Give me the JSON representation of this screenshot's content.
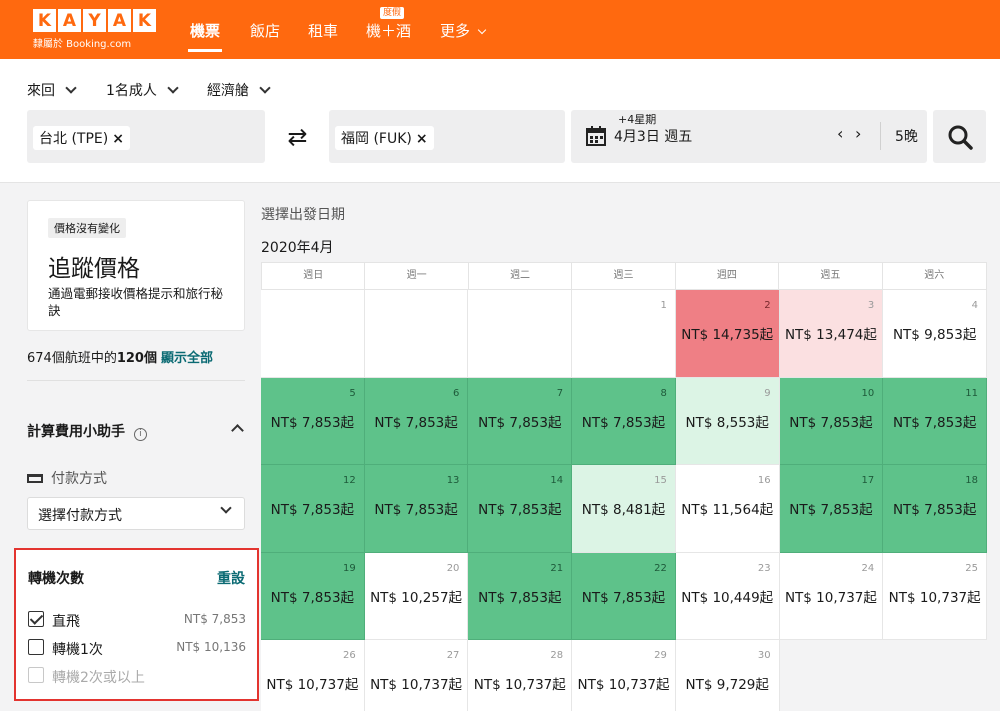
{
  "header": {
    "logo_letters": [
      "K",
      "A",
      "Y",
      "A",
      "K"
    ],
    "logo_sub": "隸屬於 Booking.com",
    "nav": [
      {
        "label": "機票",
        "active": true
      },
      {
        "label": "飯店",
        "active": false
      },
      {
        "label": "租車",
        "active": false
      },
      {
        "label": "機＋酒",
        "active": false
      },
      {
        "label": "更多",
        "active": false
      }
    ],
    "vacation_badge": "度假"
  },
  "search": {
    "trip_type": "來回",
    "travelers": "1名成人",
    "cabin": "經濟艙",
    "origin": "台北 (TPE)",
    "destination": "福岡 (FUK)",
    "date_hint": "+4星期",
    "date": "4月3日 週五",
    "nights": "5晚"
  },
  "sidebar": {
    "track_tag": "價格沒有變化",
    "track_title": "追蹤價格",
    "track_desc": "通過電郵接收價格提示和旅行秘訣",
    "count_total": "674個航班中的",
    "count_shown": "120個",
    "show_all": "顯示全部",
    "calc_title": "計算費用小助手",
    "pay_label": "付款方式",
    "pay_select": "選擇付款方式",
    "stops_title": "轉機次數",
    "stops_reset": "重設",
    "stops": [
      {
        "label": "直飛",
        "price": "NT$ 7,853",
        "checked": true,
        "disabled": false
      },
      {
        "label": "轉機1次",
        "price": "NT$ 10,136",
        "checked": false,
        "disabled": false
      },
      {
        "label": "轉機2次或以上",
        "price": "",
        "checked": false,
        "disabled": true
      }
    ]
  },
  "calendar": {
    "heading": "選擇出發日期",
    "month": "2020年4月",
    "weekdays": [
      "週日",
      "週一",
      "週二",
      "週三",
      "週四",
      "週五",
      "週六"
    ],
    "days": [
      {
        "d": "",
        "p": "",
        "c": ""
      },
      {
        "d": "",
        "p": "",
        "c": ""
      },
      {
        "d": "",
        "p": "",
        "c": ""
      },
      {
        "d": "1",
        "p": "",
        "c": ""
      },
      {
        "d": "2",
        "p": "NT$ 14,735起",
        "c": "red"
      },
      {
        "d": "3",
        "p": "NT$ 13,474起",
        "c": "pink"
      },
      {
        "d": "4",
        "p": "NT$ 9,853起",
        "c": ""
      },
      {
        "d": "5",
        "p": "NT$ 7,853起",
        "c": "green"
      },
      {
        "d": "6",
        "p": "NT$ 7,853起",
        "c": "green"
      },
      {
        "d": "7",
        "p": "NT$ 7,853起",
        "c": "green"
      },
      {
        "d": "8",
        "p": "NT$ 7,853起",
        "c": "green"
      },
      {
        "d": "9",
        "p": "NT$ 8,553起",
        "c": "lgreen"
      },
      {
        "d": "10",
        "p": "NT$ 7,853起",
        "c": "green"
      },
      {
        "d": "11",
        "p": "NT$ 7,853起",
        "c": "green"
      },
      {
        "d": "12",
        "p": "NT$ 7,853起",
        "c": "green"
      },
      {
        "d": "13",
        "p": "NT$ 7,853起",
        "c": "green"
      },
      {
        "d": "14",
        "p": "NT$ 7,853起",
        "c": "green"
      },
      {
        "d": "15",
        "p": "NT$ 8,481起",
        "c": "lgreen"
      },
      {
        "d": "16",
        "p": "NT$ 11,564起",
        "c": ""
      },
      {
        "d": "17",
        "p": "NT$ 7,853起",
        "c": "green"
      },
      {
        "d": "18",
        "p": "NT$ 7,853起",
        "c": "green"
      },
      {
        "d": "19",
        "p": "NT$ 7,853起",
        "c": "green"
      },
      {
        "d": "20",
        "p": "NT$ 10,257起",
        "c": ""
      },
      {
        "d": "21",
        "p": "NT$ 7,853起",
        "c": "green"
      },
      {
        "d": "22",
        "p": "NT$ 7,853起",
        "c": "green"
      },
      {
        "d": "23",
        "p": "NT$ 10,449起",
        "c": ""
      },
      {
        "d": "24",
        "p": "NT$ 10,737起",
        "c": ""
      },
      {
        "d": "25",
        "p": "NT$ 10,737起",
        "c": ""
      },
      {
        "d": "26",
        "p": "NT$ 10,737起",
        "c": ""
      },
      {
        "d": "27",
        "p": "NT$ 10,737起",
        "c": ""
      },
      {
        "d": "28",
        "p": "NT$ 10,737起",
        "c": ""
      },
      {
        "d": "29",
        "p": "NT$ 10,737起",
        "c": ""
      },
      {
        "d": "30",
        "p": "NT$ 9,729起",
        "c": ""
      }
    ]
  }
}
